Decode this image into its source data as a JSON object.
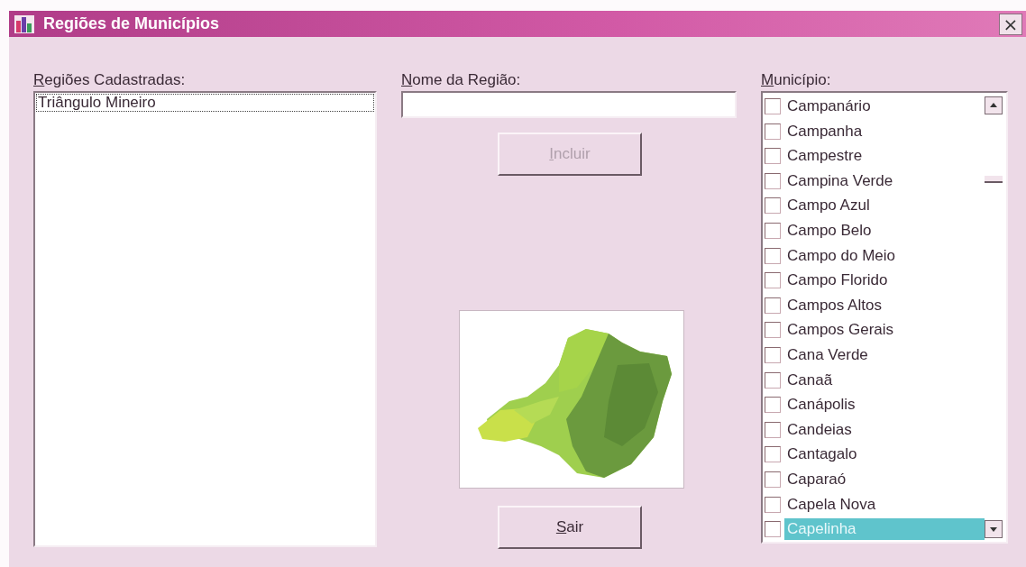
{
  "window": {
    "title": "Regiões de Municípios",
    "close": "×"
  },
  "regions": {
    "label": "Regiões Cadastradas:",
    "mnemonic": true,
    "items": [
      {
        "text": "Triângulo Mineiro",
        "focused": true
      }
    ]
  },
  "region_name": {
    "label": "Nome da Região:",
    "mnemonic": true
  },
  "add_button": {
    "label": "Incluir",
    "mnemonic": true,
    "disabled": true
  },
  "exit_button": {
    "label": "Sair",
    "mnemonic": true,
    "disabled": false
  },
  "municipalities": {
    "label": "Município:",
    "mnemonic": true,
    "items": [
      {
        "text": "Campanário",
        "checked": false,
        "selected": false
      },
      {
        "text": "Campanha",
        "checked": false,
        "selected": false
      },
      {
        "text": "Campestre",
        "checked": false,
        "selected": false
      },
      {
        "text": "Campina Verde",
        "checked": false,
        "selected": false
      },
      {
        "text": "Campo Azul",
        "checked": false,
        "selected": false
      },
      {
        "text": "Campo Belo",
        "checked": false,
        "selected": false
      },
      {
        "text": "Campo do Meio",
        "checked": false,
        "selected": false
      },
      {
        "text": "Campo Florido",
        "checked": false,
        "selected": false
      },
      {
        "text": "Campos Altos",
        "checked": false,
        "selected": false
      },
      {
        "text": "Campos Gerais",
        "checked": false,
        "selected": false
      },
      {
        "text": "Cana Verde",
        "checked": false,
        "selected": false
      },
      {
        "text": "Canaã",
        "checked": false,
        "selected": false
      },
      {
        "text": "Canápolis",
        "checked": false,
        "selected": false
      },
      {
        "text": "Candeias",
        "checked": false,
        "selected": false
      },
      {
        "text": "Cantagalo",
        "checked": false,
        "selected": false
      },
      {
        "text": "Caparaó",
        "checked": false,
        "selected": false
      },
      {
        "text": "Capela Nova",
        "checked": false,
        "selected": false
      },
      {
        "text": "Capelinha",
        "checked": false,
        "selected": true
      }
    ]
  }
}
